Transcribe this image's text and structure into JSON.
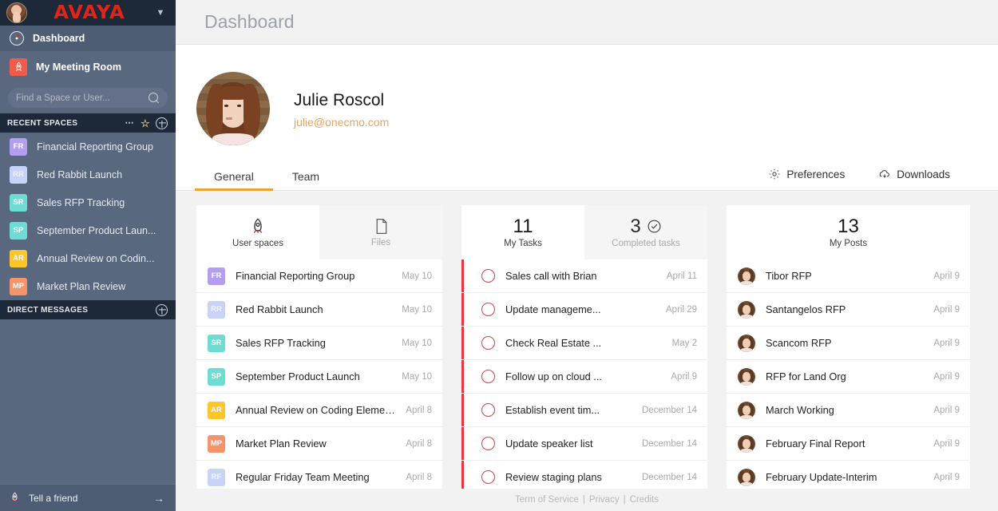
{
  "sidebar": {
    "brand": "AVAYA",
    "chevron_icon": "chevron-down-icon",
    "nav": [
      {
        "label": "Dashboard",
        "icon": "gauge-icon"
      },
      {
        "label": "My Meeting Room",
        "icon": "rocket-icon"
      }
    ],
    "search": {
      "placeholder": "Find a Space or User...",
      "value": "",
      "icon": "search-icon"
    },
    "recent_spaces_header": {
      "label": "RECENT SPACES",
      "more_icon": "ellipsis-icon",
      "star_icon": "star-icon",
      "add_icon": "plus-circle-icon"
    },
    "spaces": [
      {
        "initials": "FR",
        "label": "Financial Reporting Group",
        "color": "#b49ef0"
      },
      {
        "initials": "RR",
        "label": "Red Rabbit Launch",
        "color": "#c9d2f7"
      },
      {
        "initials": "SR",
        "label": "Sales RFP Tracking",
        "color": "#6fdcd4"
      },
      {
        "initials": "SP",
        "label": "September Product Laun...",
        "color": "#6fdcd4"
      },
      {
        "initials": "AR",
        "label": "Annual Review on Codin...",
        "color": "#ffc52d"
      },
      {
        "initials": "MP",
        "label": "Market Plan Review",
        "color": "#f5936a"
      }
    ],
    "direct_messages_header": {
      "label": "DIRECT MESSAGES",
      "add_icon": "plus-circle-icon"
    },
    "tell_a_friend": {
      "label": "Tell a friend",
      "icon": "rocket-icon",
      "arrow_icon": "arrow-right-icon"
    }
  },
  "header": {
    "title": "Dashboard"
  },
  "profile": {
    "avatar": "user-avatar",
    "name": "Julie Roscol",
    "email": "julie@onecmo.com"
  },
  "tabs": [
    {
      "label": "General",
      "active": true
    },
    {
      "label": "Team",
      "active": false
    }
  ],
  "actions": [
    {
      "label": "Preferences",
      "icon": "gear-icon"
    },
    {
      "label": "Downloads",
      "icon": "cloud-download-icon"
    }
  ],
  "cards": {
    "spaces_card": {
      "tabs": [
        {
          "label": "User spaces",
          "icon": "rocket-icon",
          "active": true
        },
        {
          "label": "Files",
          "icon": "file-icon",
          "active": false
        }
      ],
      "items": [
        {
          "initials": "FR",
          "name": "Financial Reporting Group",
          "date": "May 10",
          "color": "#b49ef0"
        },
        {
          "initials": "RR",
          "name": "Red Rabbit Launch",
          "date": "May 10",
          "color": "#c9d2f7"
        },
        {
          "initials": "SR",
          "name": "Sales RFP Tracking",
          "date": "May 10",
          "color": "#6fdcd4"
        },
        {
          "initials": "SP",
          "name": "September Product Launch",
          "date": "May 10",
          "color": "#6fdcd4"
        },
        {
          "initials": "AR",
          "name": "Annual Review on Coding Elements",
          "date": "April 8",
          "color": "#ffc52d"
        },
        {
          "initials": "MP",
          "name": "Market Plan Review",
          "date": "April 8",
          "color": "#f5936a"
        },
        {
          "initials": "RF",
          "name": "Regular Friday Team Meeting",
          "date": "April 8",
          "color": "#c9d2f7"
        }
      ]
    },
    "tasks_card": {
      "tabs": [
        {
          "count": "11",
          "label": "My Tasks",
          "active": true,
          "icon": ""
        },
        {
          "count": "3",
          "label": "Completed tasks",
          "active": false,
          "icon": "check-circle-icon"
        }
      ],
      "items": [
        {
          "name": "Sales call with Brian",
          "date": "April 11"
        },
        {
          "name": "Update manageme...",
          "date": "April 29"
        },
        {
          "name": "Check Real Estate ...",
          "date": "May 2"
        },
        {
          "name": "Follow up on cloud ...",
          "date": "April 9"
        },
        {
          "name": "Establish event tim...",
          "date": "December 14"
        },
        {
          "name": "Update speaker list",
          "date": "December 14"
        },
        {
          "name": "Review staging plans",
          "date": "December 14"
        }
      ]
    },
    "posts_card": {
      "tabs": [
        {
          "count": "13",
          "label": "My Posts",
          "active": true
        }
      ],
      "items": [
        {
          "name": "Tibor RFP",
          "date": "April 9"
        },
        {
          "name": "Santangelos RFP",
          "date": "April 9"
        },
        {
          "name": "Scancom RFP",
          "date": "April 9"
        },
        {
          "name": "RFP for Land Org",
          "date": "April 9"
        },
        {
          "name": "March Working",
          "date": "April 9"
        },
        {
          "name": "February Final Report",
          "date": "April 9"
        },
        {
          "name": "February Update-Interim",
          "date": "April 9"
        }
      ]
    }
  },
  "footer": {
    "terms": "Term of Service",
    "privacy": "Privacy",
    "credits": "Credits",
    "separator": "|"
  },
  "colors": {
    "brand_red": "#e2231a",
    "accent_orange": "#f0a430",
    "task_red": "#e8383d",
    "sidebar": "#59677f",
    "sidebar_dark": "#1d2939",
    "email_orange": "#e8a45c"
  }
}
